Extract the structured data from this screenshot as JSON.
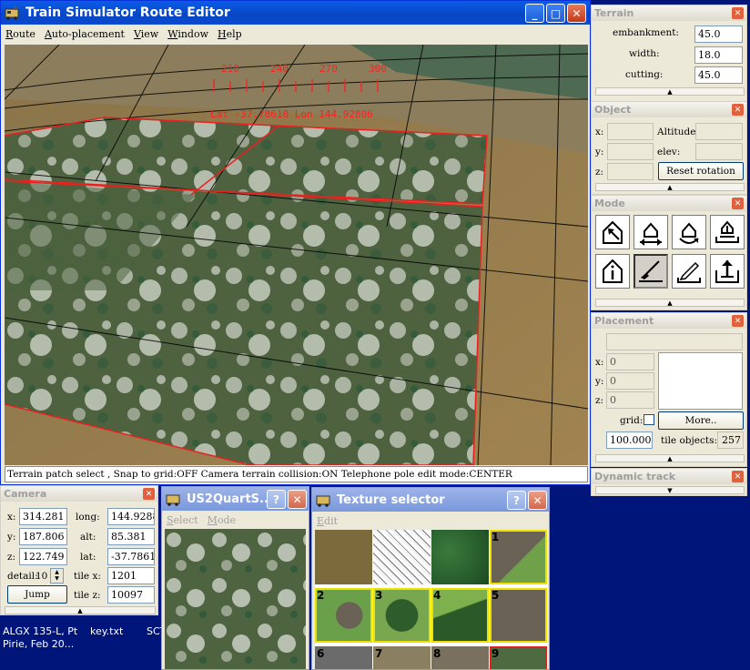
{
  "main_window": {
    "title": "Train Simulator Route Editor",
    "menu": [
      "Route",
      "Auto-placement",
      "View",
      "Window",
      "Help"
    ],
    "status": "Terrain patch select , Snap to grid:OFF Camera terrain collision:ON Telephone pole edit mode:CENTER",
    "hud": {
      "compass": [
        "210",
        "240",
        "270",
        "300"
      ],
      "latlon": "Lat -37.78618 Lon 144.92806"
    }
  },
  "terrain_panel": {
    "title": "Terrain",
    "embankment_label": "embankment:",
    "embankment": "45.0",
    "width_label": "width:",
    "width": "18.0",
    "cutting_label": "cutting:",
    "cutting": "45.0"
  },
  "object_panel": {
    "title": "Object",
    "x_label": "x:",
    "y_label": "y:",
    "z_label": "z:",
    "altitude_label": "Altitude",
    "elev_label": "elev:",
    "reset_rotation": "Reset rotation"
  },
  "mode_panel": {
    "title": "Mode",
    "icons": [
      "select-mode-icon",
      "move-mode-icon",
      "rotate-mode-icon",
      "elevate-mode-icon",
      "info-mode-icon",
      "paint-mode-icon",
      "pencil-mode-icon",
      "export-mode-icon"
    ]
  },
  "placement_panel": {
    "title": "Placement",
    "x_label": "x:",
    "x": "0",
    "y_label": "y:",
    "y": "0",
    "z_label": "z:",
    "z": "0",
    "grid_label": "grid:",
    "more": "More..",
    "value": "100.000",
    "tile_objects_label": "tile objects:",
    "tile_objects": "257"
  },
  "dynamic_track_panel": {
    "title": "Dynamic track"
  },
  "camera_panel": {
    "title": "Camera",
    "x_label": "x:",
    "x": "314.281",
    "y_label": "y:",
    "y": "187.806",
    "z_label": "z:",
    "z": "122.749",
    "long_label": "long:",
    "long": "144.9288",
    "alt_label": "alt:",
    "alt": "85.381",
    "lat_label": "lat:",
    "lat": "-37.7861",
    "detail_label": "detail:",
    "detail": "10",
    "tilex_label": "tile x:",
    "tilex": "1201",
    "tilez_label": "tile z:",
    "tilez": "10097",
    "jump": "Jump"
  },
  "us2_window": {
    "title": "US2QuartS...",
    "menu": [
      "Select",
      "Mode"
    ]
  },
  "texture_window": {
    "title": "Texture selector",
    "menu": [
      "Edit"
    ],
    "tile_numbers": [
      "1",
      "2",
      "3",
      "4",
      "5",
      "6",
      "7",
      "8",
      "9"
    ]
  },
  "desktop": {
    "items": [
      "ALGX 135-L, Pt",
      "Pirie, Feb 20...",
      "key.txt",
      "SCT"
    ]
  },
  "colors": {
    "xp_blue": "#0a5ce8",
    "close_red": "#e0613c",
    "hud_red": "#ff2020",
    "selection_yellow": "#f0e000"
  }
}
